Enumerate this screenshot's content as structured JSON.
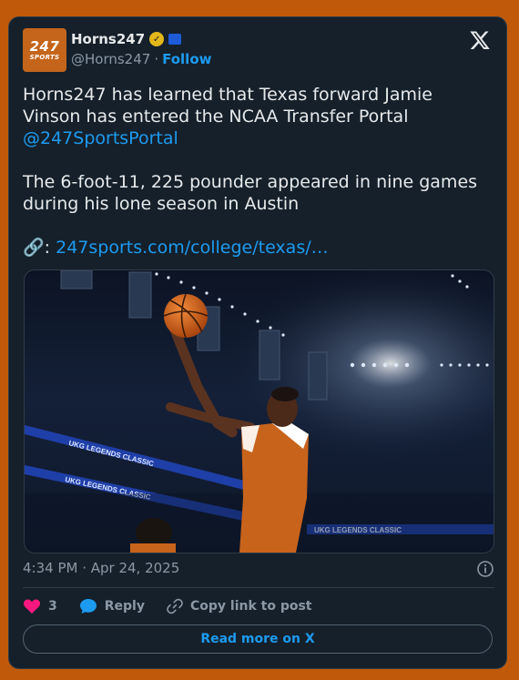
{
  "author": {
    "display_name": "Horns247",
    "handle": "@Horns247",
    "separator": "·",
    "follow_label": "Follow",
    "avatar_text_big": "247",
    "avatar_text_small": "SPORTS",
    "affiliate_badge": "BLUE"
  },
  "tweet": {
    "line1": "Horns247 has learned that Texas forward Jamie Vinson has entered the NCAA Transfer Portal",
    "mention": "@247SportsPortal",
    "line2": "The 6-foot-11, 225 pounder appeared in nine games during his lone season in Austin",
    "link_emoji": "🔗",
    "link_prefix": ":",
    "link_text": "247sports.com/college/texas/…"
  },
  "media": {
    "banner_text": "UKG LEGENDS CLASSIC"
  },
  "timestamp": "4:34 PM · Apr 24, 2025",
  "actions": {
    "like_count": "3",
    "reply_label": "Reply",
    "copy_label": "Copy link to post"
  },
  "read_more_label": "Read more on X",
  "colors": {
    "background": "#c05a0a",
    "card": "#15202b",
    "accent": "#1d9bf0",
    "like": "#f91880"
  }
}
